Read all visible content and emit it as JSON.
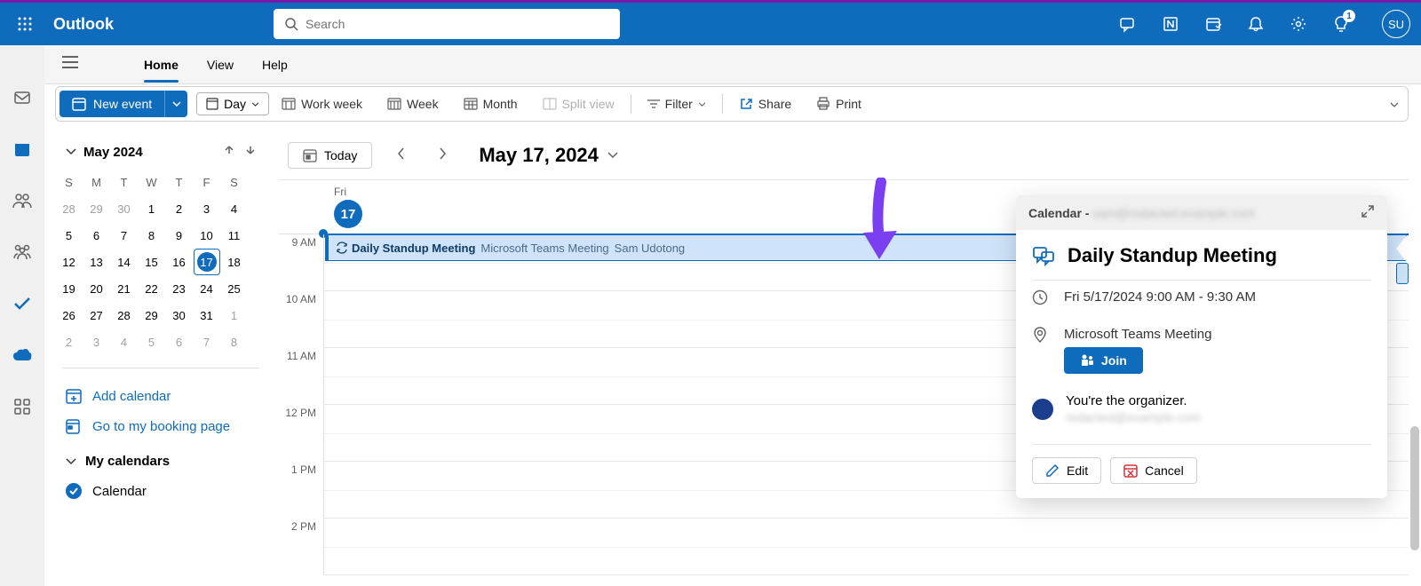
{
  "header": {
    "brand": "Outlook",
    "search_placeholder": "Search",
    "avatar_initials": "SU",
    "tips_badge": "1"
  },
  "nav": {
    "tabs": [
      "Home",
      "View",
      "Help"
    ],
    "active_index": 0
  },
  "toolbar": {
    "new_event": "New event",
    "day": "Day",
    "work_week": "Work week",
    "week": "Week",
    "month": "Month",
    "split_view": "Split view",
    "filter": "Filter",
    "share": "Share",
    "print": "Print"
  },
  "sidebar": {
    "month_title": "May 2024",
    "weekdays": [
      "S",
      "M",
      "T",
      "W",
      "T",
      "F",
      "S"
    ],
    "weeks": [
      [
        {
          "d": "28",
          "o": true
        },
        {
          "d": "29",
          "o": true
        },
        {
          "d": "30",
          "o": true
        },
        {
          "d": "1"
        },
        {
          "d": "2"
        },
        {
          "d": "3"
        },
        {
          "d": "4"
        }
      ],
      [
        {
          "d": "5"
        },
        {
          "d": "6"
        },
        {
          "d": "7"
        },
        {
          "d": "8"
        },
        {
          "d": "9"
        },
        {
          "d": "10"
        },
        {
          "d": "11"
        }
      ],
      [
        {
          "d": "12"
        },
        {
          "d": "13"
        },
        {
          "d": "14"
        },
        {
          "d": "15"
        },
        {
          "d": "16"
        },
        {
          "d": "17",
          "today": true
        },
        {
          "d": "18"
        }
      ],
      [
        {
          "d": "19"
        },
        {
          "d": "20"
        },
        {
          "d": "21"
        },
        {
          "d": "22"
        },
        {
          "d": "23"
        },
        {
          "d": "24"
        },
        {
          "d": "25"
        }
      ],
      [
        {
          "d": "26"
        },
        {
          "d": "27"
        },
        {
          "d": "28"
        },
        {
          "d": "29"
        },
        {
          "d": "30"
        },
        {
          "d": "31"
        },
        {
          "d": "1",
          "o": true
        }
      ],
      [
        {
          "d": "2",
          "o": true
        },
        {
          "d": "3",
          "o": true
        },
        {
          "d": "4",
          "o": true
        },
        {
          "d": "5",
          "o": true
        },
        {
          "d": "6",
          "o": true
        },
        {
          "d": "7",
          "o": true
        },
        {
          "d": "8",
          "o": true
        }
      ]
    ],
    "add_calendar": "Add calendar",
    "booking_page": "Go to my booking page",
    "my_calendars": "My calendars",
    "calendar_item": "Calendar"
  },
  "main": {
    "today_label": "Today",
    "date_title": "May 17, 2024",
    "day_name": "Fri",
    "day_number": "17",
    "hours": [
      "9 AM",
      "10 AM",
      "11 AM",
      "12 PM",
      "1 PM",
      "2 PM"
    ]
  },
  "event": {
    "title": "Daily Standup Meeting",
    "location": "Microsoft Teams Meeting",
    "organizer": "Sam Udotong"
  },
  "popup": {
    "source_label": "Calendar -",
    "source_email": "sam@redacted.example.com",
    "title": "Daily Standup Meeting",
    "time": "Fri 5/17/2024 9:00 AM - 9:30 AM",
    "location": "Microsoft Teams Meeting",
    "join": "Join",
    "organizer_text": "You're the organizer.",
    "organizer_email": "redacted@example.com",
    "edit": "Edit",
    "cancel": "Cancel"
  }
}
